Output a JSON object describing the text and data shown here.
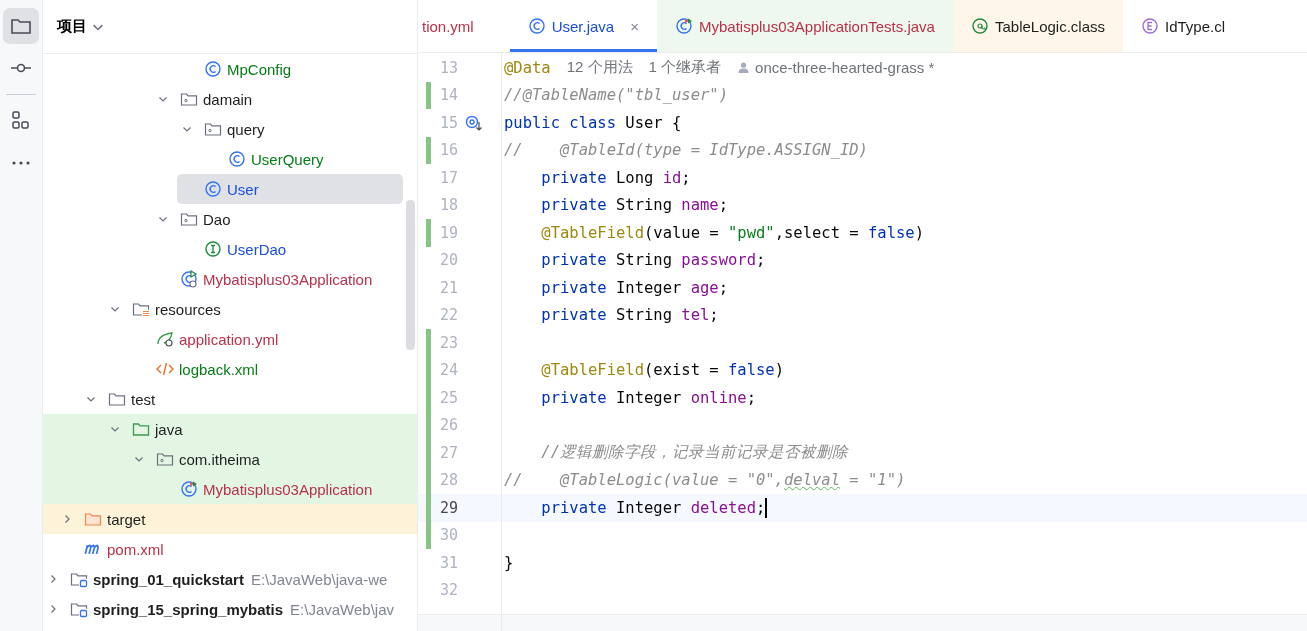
{
  "activity_bar": [
    {
      "kind": "folder",
      "selected": true
    },
    {
      "kind": "commit",
      "selected": false
    },
    {
      "kind": "structure",
      "selected": false
    },
    {
      "kind": "more",
      "selected": false
    }
  ],
  "project_panel": {
    "title": "项目",
    "tree": [
      {
        "children": [
          {
            "children": [
              {
                "children": [
                  {
                    "children": [
                      {
                        "children": [
                          {
                            "children": [
                              {
                                "label": "MpConfig",
                                "kind": "class",
                                "color": "#067d17",
                                "selected": false
                              }
                            ]
                          },
                          {
                            "label": "damain",
                            "kind": "package",
                            "expanded": true,
                            "selected": false,
                            "children": [
                              {
                                "label": "query",
                                "kind": "package",
                                "expanded": true,
                                "selected": false,
                                "children": [
                                  {
                                    "label": "UserQuery",
                                    "kind": "class",
                                    "color": "#067d17",
                                    "selected": false
                                  }
                                ]
                              },
                              {
                                "label": "User",
                                "kind": "class",
                                "color": "#1a4fd6",
                                "selected": true
                              }
                            ]
                          },
                          {
                            "label": "Dao",
                            "kind": "package",
                            "expanded": true,
                            "selected": false,
                            "children": [
                              {
                                "label": "UserDao",
                                "kind": "interface",
                                "color": "#1a4fd6",
                                "selected": false
                              }
                            ]
                          },
                          {
                            "label": "Mybatisplus03Application",
                            "kind": "spring-class",
                            "color": "#b8324a",
                            "selected": false
                          }
                        ]
                      }
                    ]
                  },
                  {
                    "label": "resources",
                    "kind": "resources",
                    "expanded": true,
                    "selected": false,
                    "children": [
                      {
                        "label": "application.yml",
                        "kind": "spring-config",
                        "color": "#b8324a",
                        "selected": false
                      },
                      {
                        "label": "logback.xml",
                        "kind": "xml",
                        "color": "#067d17",
                        "selected": false
                      }
                    ]
                  }
                ]
              },
              {
                "label": "test",
                "kind": "folder",
                "expanded": true,
                "selected": false,
                "children": [
                  {
                    "label": "java",
                    "kind": "test-folder",
                    "expanded": true,
                    "test_source": true,
                    "selected": false,
                    "children": [
                      {
                        "label": "com.itheima",
                        "kind": "package",
                        "expanded": true,
                        "test_source": true,
                        "selected": false,
                        "children": [
                          {
                            "label": "Mybatisplus03Application",
                            "kind": "test-class",
                            "color": "#b8324a",
                            "test_source": true,
                            "selected": false
                          }
                        ]
                      }
                    ]
                  }
                ]
              }
            ]
          },
          {
            "label": "target",
            "kind": "excluded-folder",
            "expanded": false,
            "excluded": true,
            "selected": false
          },
          {
            "label": "pom.xml",
            "kind": "maven",
            "color": "#b8324a",
            "selected": false
          }
        ]
      },
      {
        "label": "spring_01_quickstart",
        "kind": "module",
        "expanded": false,
        "path": "E:\\JavaWeb\\java-we",
        "selected": false
      },
      {
        "label": "spring_15_spring_mybatis",
        "kind": "module",
        "expanded": false,
        "path": "E:\\JavaWeb\\jav",
        "selected": false
      }
    ]
  },
  "tabs": [
    {
      "label": "tion.yml",
      "color": "#b8324a",
      "selected": false
    },
    {
      "label": "User.java",
      "kind": "class",
      "color": "#1a4fd6",
      "selected": true,
      "close": "×"
    },
    {
      "label": "Mybatisplus03ApplicationTests.java",
      "kind": "test-class",
      "color": "#b8324a",
      "test_source": true,
      "selected": false
    },
    {
      "label": "TableLogic.class",
      "kind": "annotation",
      "library": true,
      "selected": false
    },
    {
      "label": "IdType.cl",
      "kind": "enum",
      "selected": false
    }
  ],
  "editor": {
    "lines": [
      {
        "number": "13",
        "tokens": [
          {
            "text": "@Data",
            "kind": "annotation"
          }
        ],
        "hints": [
          {
            "text": "12 个用法"
          },
          {
            "text": "1 个继承者"
          },
          {
            "text": "once-three-hearted-grass *",
            "kind": "author"
          }
        ]
      },
      {
        "number": "14",
        "changed": true,
        "tokens": [
          {
            "text": "//@TableName(\"tbl_user\")",
            "kind": "comment"
          }
        ]
      },
      {
        "number": "15",
        "has_implementations": true,
        "tokens": [
          {
            "text": "public class",
            "kind": "keyword"
          },
          {
            "text": " User {",
            "kind": "plain"
          }
        ]
      },
      {
        "number": "16",
        "changed": true,
        "tokens": [
          {
            "text": "//    @TableId(type = IdType.ASSIGN_ID)",
            "kind": "comment"
          }
        ]
      },
      {
        "number": "17",
        "tokens": [
          {
            "text": "    private",
            "kind": "keyword"
          },
          {
            "text": " Long ",
            "kind": "plain"
          },
          {
            "text": "id",
            "kind": "field"
          },
          {
            "text": ";",
            "kind": "plain"
          }
        ]
      },
      {
        "number": "18",
        "tokens": [
          {
            "text": "    private",
            "kind": "keyword"
          },
          {
            "text": " String ",
            "kind": "plain"
          },
          {
            "text": "name",
            "kind": "field"
          },
          {
            "text": ";",
            "kind": "plain"
          }
        ]
      },
      {
        "number": "19",
        "changed": true,
        "tokens": [
          {
            "text": "    @TableField",
            "kind": "annotation"
          },
          {
            "text": "(value = ",
            "kind": "plain"
          },
          {
            "text": "\"pwd\"",
            "kind": "string"
          },
          {
            "text": ",select = ",
            "kind": "plain"
          },
          {
            "text": "false",
            "kind": "keyword"
          },
          {
            "text": ")",
            "kind": "plain"
          }
        ]
      },
      {
        "number": "20",
        "tokens": [
          {
            "text": "    private",
            "kind": "keyword"
          },
          {
            "text": " String ",
            "kind": "plain"
          },
          {
            "text": "password",
            "kind": "field"
          },
          {
            "text": ";",
            "kind": "plain"
          }
        ]
      },
      {
        "number": "21",
        "tokens": [
          {
            "text": "    private",
            "kind": "keyword"
          },
          {
            "text": " Integer ",
            "kind": "plain"
          },
          {
            "text": "age",
            "kind": "field"
          },
          {
            "text": ";",
            "kind": "plain"
          }
        ]
      },
      {
        "number": "22",
        "tokens": [
          {
            "text": "    private",
            "kind": "keyword"
          },
          {
            "text": " String ",
            "kind": "plain"
          },
          {
            "text": "tel",
            "kind": "field"
          },
          {
            "text": ";",
            "kind": "plain"
          }
        ]
      },
      {
        "number": "23",
        "changed": true
      },
      {
        "number": "24",
        "changed": true,
        "tokens": [
          {
            "text": "    @TableField",
            "kind": "annotation"
          },
          {
            "text": "(exist = ",
            "kind": "plain"
          },
          {
            "text": "false",
            "kind": "keyword"
          },
          {
            "text": ")",
            "kind": "plain"
          }
        ]
      },
      {
        "number": "25",
        "changed": true,
        "tokens": [
          {
            "text": "    private",
            "kind": "keyword"
          },
          {
            "text": " Integer ",
            "kind": "plain"
          },
          {
            "text": "online",
            "kind": "field"
          },
          {
            "text": ";",
            "kind": "plain"
          }
        ]
      },
      {
        "number": "26",
        "changed": true
      },
      {
        "number": "27",
        "changed": true,
        "tokens": [
          {
            "text": "    //逻辑删除字段，记录当前记录是否被删除",
            "kind": "comment"
          }
        ]
      },
      {
        "number": "28",
        "changed": true,
        "tokens": [
          {
            "text": "//    @TableLogic(value = \"0\",",
            "kind": "comment"
          },
          {
            "text": "delval",
            "kind": "comment-typo"
          },
          {
            "text": " = \"1\")",
            "kind": "comment"
          }
        ]
      },
      {
        "number": "29",
        "changed": true,
        "current": true,
        "tokens": [
          {
            "text": "    private",
            "kind": "keyword"
          },
          {
            "text": " Integer ",
            "kind": "plain"
          },
          {
            "text": "deleted",
            "kind": "field"
          },
          {
            "text": ";",
            "kind": "plain"
          }
        ]
      },
      {
        "number": "30",
        "changed": true
      },
      {
        "number": "31",
        "tokens": [
          {
            "text": "}",
            "kind": "plain"
          }
        ]
      },
      {
        "number": "32"
      }
    ]
  }
}
